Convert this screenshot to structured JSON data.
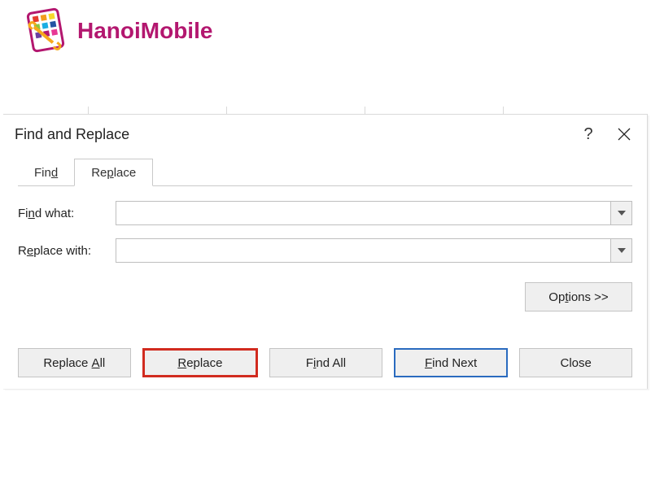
{
  "logo": {
    "text": "HanoiMobile"
  },
  "dialog": {
    "title": "Find and Replace",
    "help_symbol": "?",
    "tabs": {
      "find": "Find",
      "replace": "Replace"
    },
    "labels": {
      "find_what": "Find what:",
      "replace_with": "Replace with:"
    },
    "inputs": {
      "find_what_value": "",
      "replace_with_value": "",
      "find_what_placeholder": "",
      "replace_with_placeholder": ""
    },
    "buttons": {
      "options": "Options >>",
      "replace_all": "Replace All",
      "replace": "Replace",
      "find_all": "Find All",
      "find_next": "Find Next",
      "close": "Close"
    }
  }
}
